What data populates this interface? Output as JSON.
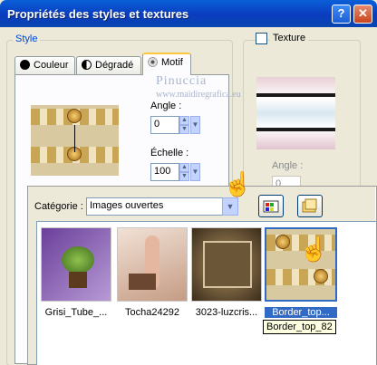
{
  "window": {
    "title": "Propriétés des styles et textures",
    "help_glyph": "?",
    "close_glyph": "✕"
  },
  "style_group": {
    "label": "Style"
  },
  "tabs": [
    {
      "label": "Couleur",
      "icon": "black-dot-icon"
    },
    {
      "label": "Dégradé",
      "icon": "gradient-icon"
    },
    {
      "label": "Motif",
      "icon": "pattern-icon",
      "selected": true
    }
  ],
  "motif": {
    "angle_label": "Angle :",
    "angle_value": "0",
    "scale_label": "Échelle :",
    "scale_value": "100"
  },
  "texture": {
    "checkbox_label": "Texture",
    "checked": false,
    "angle_label": "Angle :",
    "angle_value": "0"
  },
  "watermark": {
    "line1": "Pinuccia",
    "line2": "www.maidiregrafica.eu"
  },
  "category": {
    "label": "Catégorie :",
    "value": "Images ouvertes"
  },
  "images": [
    {
      "label": "Grisi_Tube_...",
      "colors": [
        "#6a3f9a",
        "#b89ad6"
      ]
    },
    {
      "label": "Tocha24292",
      "colors": [
        "#e7d1c2",
        "#b78a74"
      ]
    },
    {
      "label": "3023-luzcris...",
      "colors": [
        "#4a3a25",
        "#b29362"
      ]
    },
    {
      "label": "Border_top...",
      "selected": true
    }
  ],
  "tooltip": "Border_top_82",
  "colors": {
    "accent": "#316ac5",
    "tab_highlight": "#ffc83c",
    "title_bar": "#0a3cbf"
  }
}
